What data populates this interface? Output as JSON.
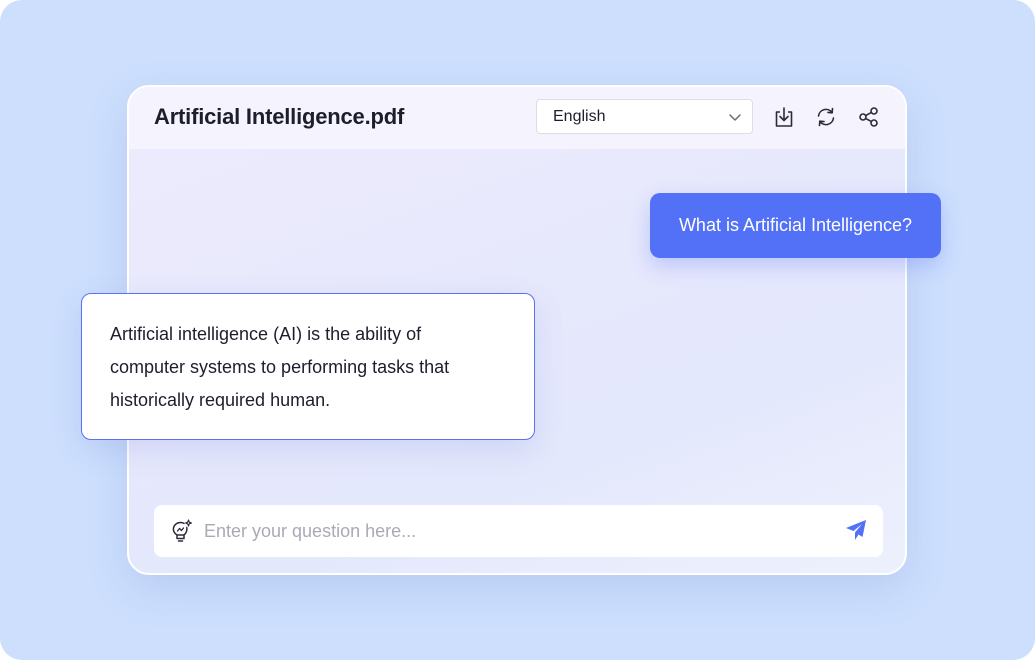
{
  "document": {
    "title": "Artificial Intelligence.pdf"
  },
  "toolbar": {
    "language": {
      "selected": "English"
    },
    "icons": [
      "download-icon",
      "refresh-icon",
      "share-icon"
    ]
  },
  "chat": {
    "user_message": "What is Artificial Intelligence?",
    "ai_response": "Artificial intelligence (AI) is the ability of computer systems to performing tasks that historically required human."
  },
  "input": {
    "placeholder": "Enter your question here...",
    "value": "",
    "icons": [
      "lightbulb-icon",
      "send-icon"
    ]
  },
  "colors": {
    "background": "#cddffd",
    "accent": "#5271f6",
    "bubble_border": "#5b73f2",
    "text": "#1d1e2c",
    "placeholder": "#a8aab6"
  }
}
